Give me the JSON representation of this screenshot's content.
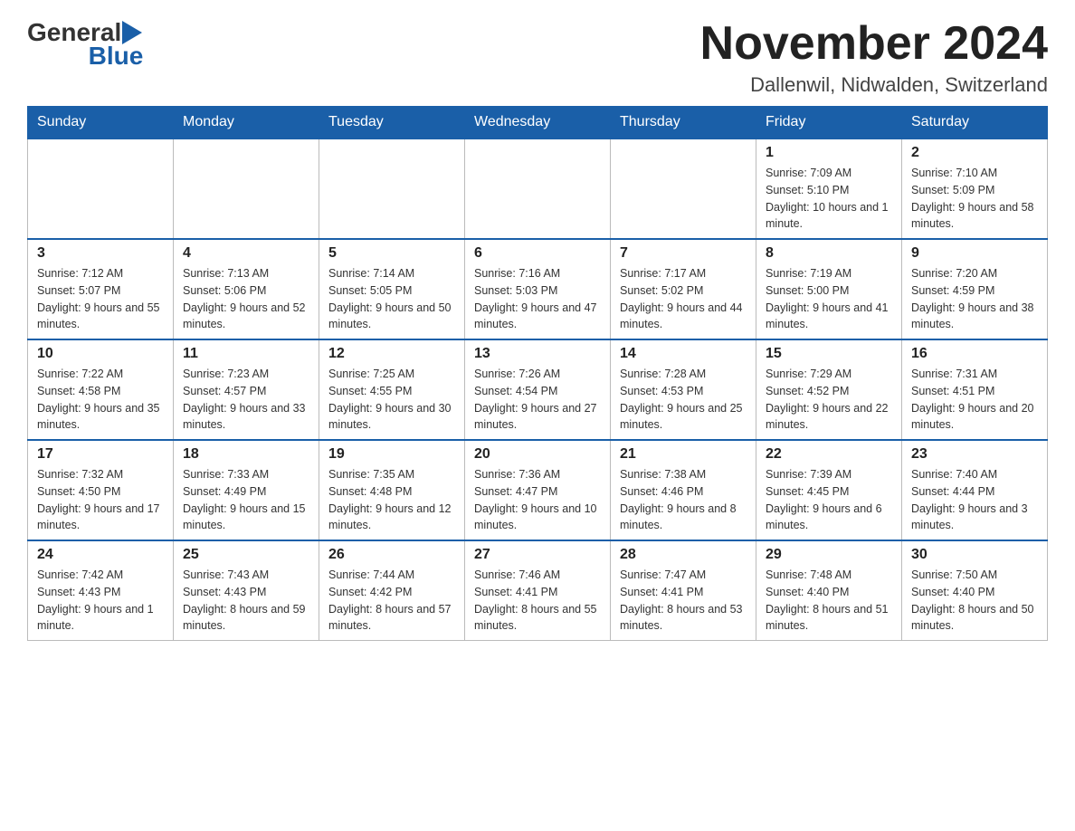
{
  "logo": {
    "text_general": "General",
    "text_blue": "Blue"
  },
  "header": {
    "month_title": "November 2024",
    "subtitle": "Dallenwil, Nidwalden, Switzerland"
  },
  "weekdays": [
    "Sunday",
    "Monday",
    "Tuesday",
    "Wednesday",
    "Thursday",
    "Friday",
    "Saturday"
  ],
  "weeks": [
    [
      {
        "day": "",
        "info": ""
      },
      {
        "day": "",
        "info": ""
      },
      {
        "day": "",
        "info": ""
      },
      {
        "day": "",
        "info": ""
      },
      {
        "day": "",
        "info": ""
      },
      {
        "day": "1",
        "info": "Sunrise: 7:09 AM\nSunset: 5:10 PM\nDaylight: 10 hours and 1 minute."
      },
      {
        "day": "2",
        "info": "Sunrise: 7:10 AM\nSunset: 5:09 PM\nDaylight: 9 hours and 58 minutes."
      }
    ],
    [
      {
        "day": "3",
        "info": "Sunrise: 7:12 AM\nSunset: 5:07 PM\nDaylight: 9 hours and 55 minutes."
      },
      {
        "day": "4",
        "info": "Sunrise: 7:13 AM\nSunset: 5:06 PM\nDaylight: 9 hours and 52 minutes."
      },
      {
        "day": "5",
        "info": "Sunrise: 7:14 AM\nSunset: 5:05 PM\nDaylight: 9 hours and 50 minutes."
      },
      {
        "day": "6",
        "info": "Sunrise: 7:16 AM\nSunset: 5:03 PM\nDaylight: 9 hours and 47 minutes."
      },
      {
        "day": "7",
        "info": "Sunrise: 7:17 AM\nSunset: 5:02 PM\nDaylight: 9 hours and 44 minutes."
      },
      {
        "day": "8",
        "info": "Sunrise: 7:19 AM\nSunset: 5:00 PM\nDaylight: 9 hours and 41 minutes."
      },
      {
        "day": "9",
        "info": "Sunrise: 7:20 AM\nSunset: 4:59 PM\nDaylight: 9 hours and 38 minutes."
      }
    ],
    [
      {
        "day": "10",
        "info": "Sunrise: 7:22 AM\nSunset: 4:58 PM\nDaylight: 9 hours and 35 minutes."
      },
      {
        "day": "11",
        "info": "Sunrise: 7:23 AM\nSunset: 4:57 PM\nDaylight: 9 hours and 33 minutes."
      },
      {
        "day": "12",
        "info": "Sunrise: 7:25 AM\nSunset: 4:55 PM\nDaylight: 9 hours and 30 minutes."
      },
      {
        "day": "13",
        "info": "Sunrise: 7:26 AM\nSunset: 4:54 PM\nDaylight: 9 hours and 27 minutes."
      },
      {
        "day": "14",
        "info": "Sunrise: 7:28 AM\nSunset: 4:53 PM\nDaylight: 9 hours and 25 minutes."
      },
      {
        "day": "15",
        "info": "Sunrise: 7:29 AM\nSunset: 4:52 PM\nDaylight: 9 hours and 22 minutes."
      },
      {
        "day": "16",
        "info": "Sunrise: 7:31 AM\nSunset: 4:51 PM\nDaylight: 9 hours and 20 minutes."
      }
    ],
    [
      {
        "day": "17",
        "info": "Sunrise: 7:32 AM\nSunset: 4:50 PM\nDaylight: 9 hours and 17 minutes."
      },
      {
        "day": "18",
        "info": "Sunrise: 7:33 AM\nSunset: 4:49 PM\nDaylight: 9 hours and 15 minutes."
      },
      {
        "day": "19",
        "info": "Sunrise: 7:35 AM\nSunset: 4:48 PM\nDaylight: 9 hours and 12 minutes."
      },
      {
        "day": "20",
        "info": "Sunrise: 7:36 AM\nSunset: 4:47 PM\nDaylight: 9 hours and 10 minutes."
      },
      {
        "day": "21",
        "info": "Sunrise: 7:38 AM\nSunset: 4:46 PM\nDaylight: 9 hours and 8 minutes."
      },
      {
        "day": "22",
        "info": "Sunrise: 7:39 AM\nSunset: 4:45 PM\nDaylight: 9 hours and 6 minutes."
      },
      {
        "day": "23",
        "info": "Sunrise: 7:40 AM\nSunset: 4:44 PM\nDaylight: 9 hours and 3 minutes."
      }
    ],
    [
      {
        "day": "24",
        "info": "Sunrise: 7:42 AM\nSunset: 4:43 PM\nDaylight: 9 hours and 1 minute."
      },
      {
        "day": "25",
        "info": "Sunrise: 7:43 AM\nSunset: 4:43 PM\nDaylight: 8 hours and 59 minutes."
      },
      {
        "day": "26",
        "info": "Sunrise: 7:44 AM\nSunset: 4:42 PM\nDaylight: 8 hours and 57 minutes."
      },
      {
        "day": "27",
        "info": "Sunrise: 7:46 AM\nSunset: 4:41 PM\nDaylight: 8 hours and 55 minutes."
      },
      {
        "day": "28",
        "info": "Sunrise: 7:47 AM\nSunset: 4:41 PM\nDaylight: 8 hours and 53 minutes."
      },
      {
        "day": "29",
        "info": "Sunrise: 7:48 AM\nSunset: 4:40 PM\nDaylight: 8 hours and 51 minutes."
      },
      {
        "day": "30",
        "info": "Sunrise: 7:50 AM\nSunset: 4:40 PM\nDaylight: 8 hours and 50 minutes."
      }
    ]
  ]
}
